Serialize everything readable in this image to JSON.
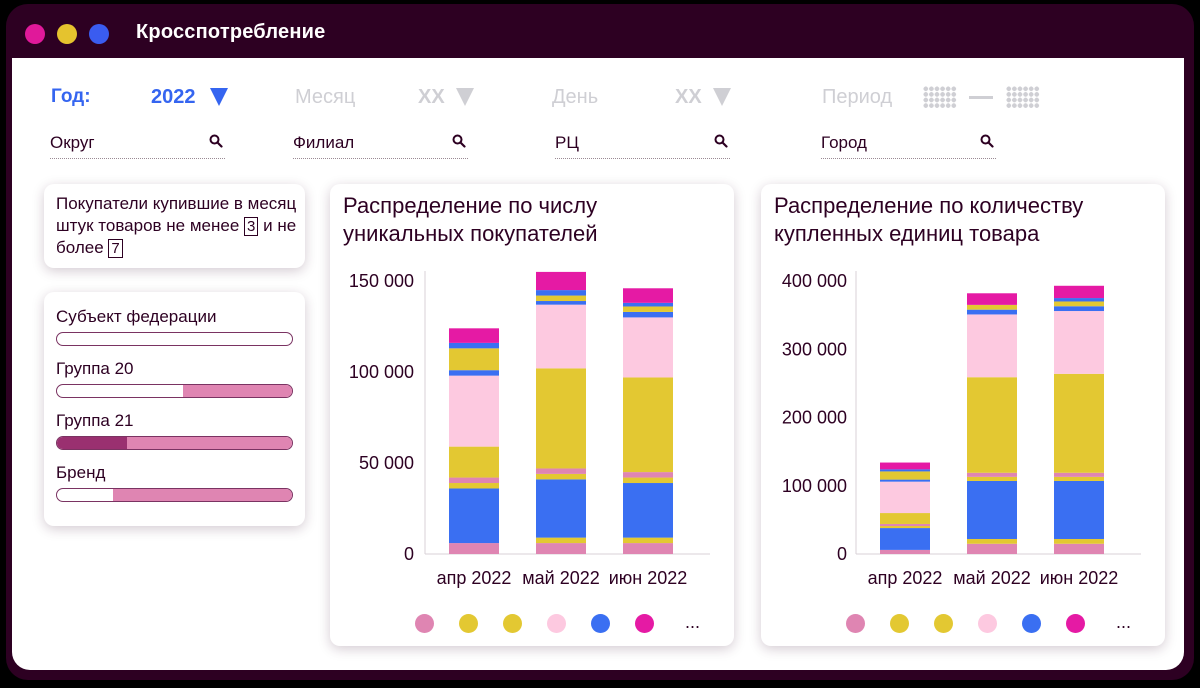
{
  "window": {
    "title": "Кросспотребление",
    "dots": [
      "#e0199a",
      "#e5c32e",
      "#3a5cf0"
    ]
  },
  "filters": {
    "year": {
      "label": "Год:",
      "value": "2022"
    },
    "month": {
      "label": "Месяц",
      "value": "XX"
    },
    "day": {
      "label": "День",
      "value": "XX"
    },
    "period": {
      "label": "Период",
      "separator": "—"
    }
  },
  "searches": [
    {
      "label": "Округ"
    },
    {
      "label": "Филиал"
    },
    {
      "label": "РЦ"
    },
    {
      "label": "Город"
    }
  ],
  "buyers": {
    "text_before": "Покупатели купившие в месяц штук товаров не менее",
    "min": "3",
    "text_middle": "и не более",
    "max": "7"
  },
  "filter_panel": {
    "items": [
      {
        "label": "Субъект федерации",
        "fill": 0
      },
      {
        "label": "Группа 20",
        "fill": 0.54
      },
      {
        "label": "Группа 21",
        "fill": 0.3
      },
      {
        "label": "Бренд",
        "fill": 0.24
      }
    ]
  },
  "colors": {
    "pink_dark": "#df85b2",
    "yellow": "#e3c832",
    "light_pink": "#fdc9e0",
    "blue": "#3a6ff2",
    "magenta": "#e51aa4",
    "bar_filled": "#df85b2",
    "bar_dark": "#9a3070"
  },
  "chart_data": [
    {
      "type": "bar",
      "title": "Распределение по числу уникальных покупателей",
      "categories": [
        "апр 2022",
        "май 2022",
        "июн 2022"
      ],
      "yticks": [
        "150 000",
        "100 000",
        "50 000",
        "0"
      ],
      "ylim": [
        0,
        150000
      ],
      "stacked": true,
      "series": [
        {
          "color": "#df85b2",
          "values": [
            6000,
            6000,
            6000
          ]
        },
        {
          "color": "#e3c832",
          "values": [
            0,
            3000,
            3000
          ]
        },
        {
          "color": "#3a6ff2",
          "values": [
            30000,
            32000,
            30000
          ]
        },
        {
          "color": "#e3c832",
          "values": [
            3000,
            3000,
            3000
          ]
        },
        {
          "color": "#df85b2",
          "values": [
            3000,
            3000,
            3000
          ]
        },
        {
          "color": "#e3c832",
          "values": [
            17000,
            55000,
            52000
          ]
        },
        {
          "color": "#fdc9e0",
          "values": [
            39000,
            35000,
            33000
          ]
        },
        {
          "color": "#3a6ff2",
          "values": [
            3000,
            2000,
            3000
          ]
        },
        {
          "color": "#e3c832",
          "values": [
            12000,
            3000,
            3000
          ]
        },
        {
          "color": "#3a6ff2",
          "values": [
            3000,
            3000,
            2000
          ]
        },
        {
          "color": "#e51aa4",
          "values": [
            8000,
            10000,
            8000
          ]
        }
      ],
      "legend_colors": [
        "#df85b2",
        "#e3c832",
        "#e3c832",
        "#fdc9e0",
        "#3a6ff2",
        "#e51aa4"
      ],
      "legend_more": "..."
    },
    {
      "type": "bar",
      "title": "Распределение по количеству купленных единиц товара",
      "categories": [
        "апр 2022",
        "май 2022",
        "июн 2022"
      ],
      "yticks": [
        "400 000",
        "300 000",
        "200 000",
        "100 000",
        "0"
      ],
      "ylim": [
        0,
        400000
      ],
      "stacked": true,
      "series": [
        {
          "color": "#df85b2",
          "values": [
            6000,
            15000,
            15000
          ]
        },
        {
          "color": "#e3c832",
          "values": [
            0,
            7000,
            7000
          ]
        },
        {
          "color": "#3a6ff2",
          "values": [
            32000,
            85000,
            85000
          ]
        },
        {
          "color": "#e3c832",
          "values": [
            3000,
            6000,
            6000
          ]
        },
        {
          "color": "#df85b2",
          "values": [
            3000,
            6000,
            6000
          ]
        },
        {
          "color": "#e3c832",
          "values": [
            16000,
            140000,
            145000
          ]
        },
        {
          "color": "#fdc9e0",
          "values": [
            46000,
            92000,
            92000
          ]
        },
        {
          "color": "#3a6ff2",
          "values": [
            3000,
            7000,
            7000
          ]
        },
        {
          "color": "#e3c832",
          "values": [
            12000,
            7000,
            7000
          ]
        },
        {
          "color": "#3a6ff2",
          "values": [
            3000,
            0,
            5000
          ]
        },
        {
          "color": "#e51aa4",
          "values": [
            10000,
            17000,
            18000
          ]
        }
      ],
      "legend_colors": [
        "#df85b2",
        "#e3c832",
        "#e3c832",
        "#fdc9e0",
        "#3a6ff2",
        "#e51aa4"
      ],
      "legend_more": "..."
    }
  ]
}
